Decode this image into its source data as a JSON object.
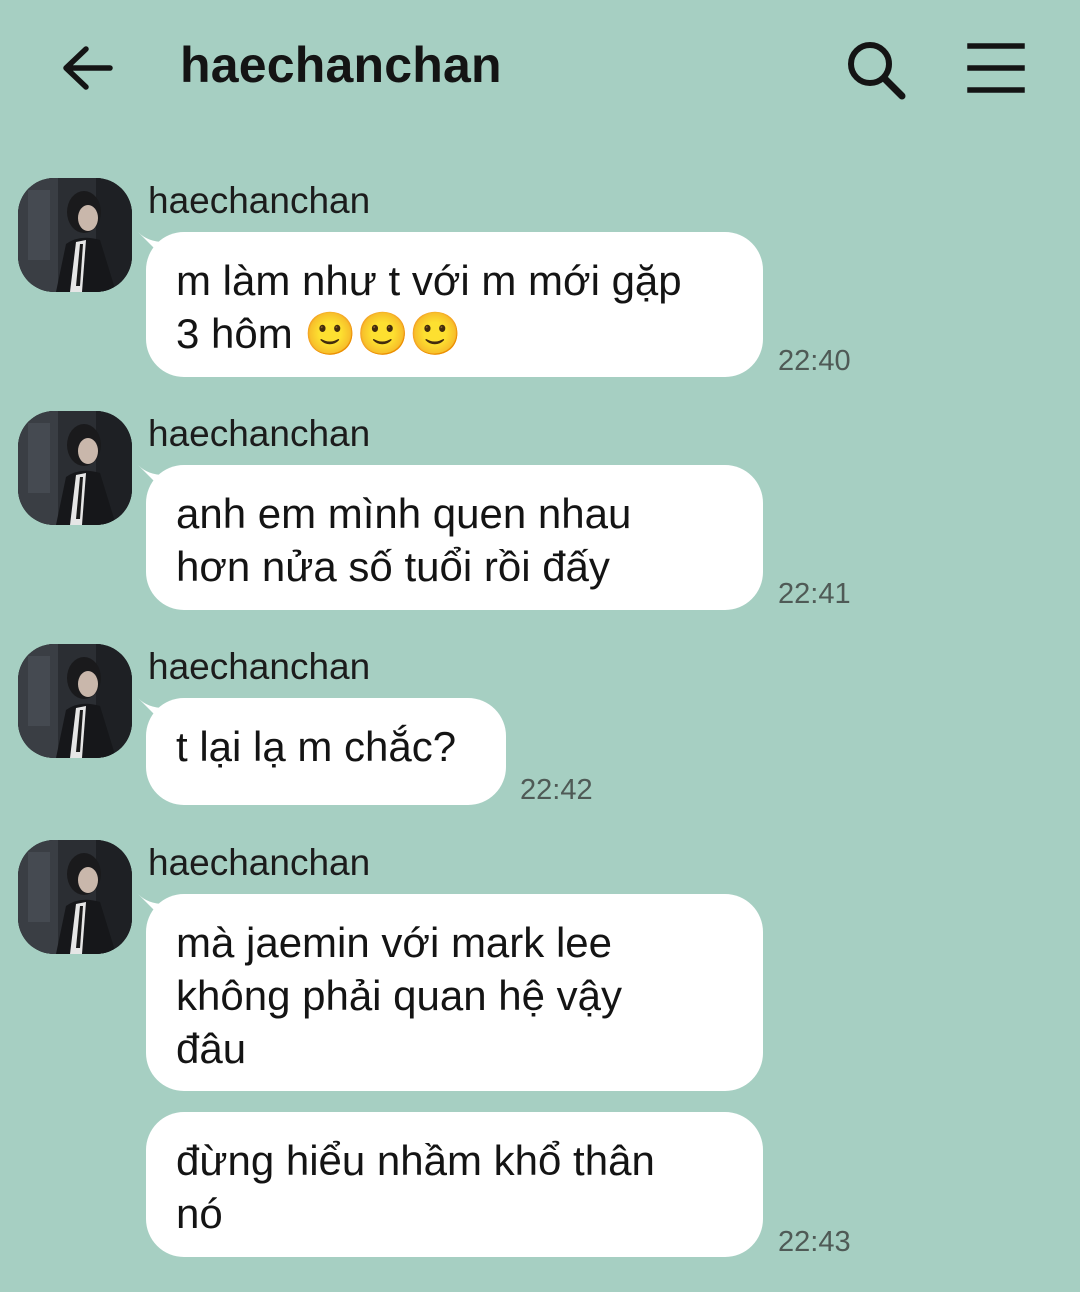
{
  "header": {
    "title": "haechanchan"
  },
  "messages": [
    {
      "sender": "haechanchan",
      "text_lines": [
        "m làm như t với m mới gặp",
        "3 hôm 🙂🙂🙂"
      ],
      "time": "22:40"
    },
    {
      "sender": "haechanchan",
      "text_lines": [
        "anh em mình quen nhau",
        "hơn nửa số tuổi rồi đấy"
      ],
      "time": "22:41"
    },
    {
      "sender": "haechanchan",
      "text_lines": [
        "t lại lạ m chắc?"
      ],
      "time": "22:42"
    },
    {
      "sender": "haechanchan",
      "text_lines": [
        "mà jaemin với mark lee",
        "không phải quan hệ vậy",
        "đâu"
      ],
      "time": ""
    },
    {
      "sender": "",
      "text_lines": [
        "đừng hiểu nhầm khổ thân",
        "nó"
      ],
      "time": "22:43"
    }
  ],
  "colors": {
    "background": "#a6cfc2",
    "bubble": "#ffffff",
    "text": "#141414",
    "timestamp": "#4f5a56"
  },
  "icons": {
    "back": "arrow-left-icon",
    "search": "search-icon",
    "menu": "hamburger-menu-icon"
  }
}
